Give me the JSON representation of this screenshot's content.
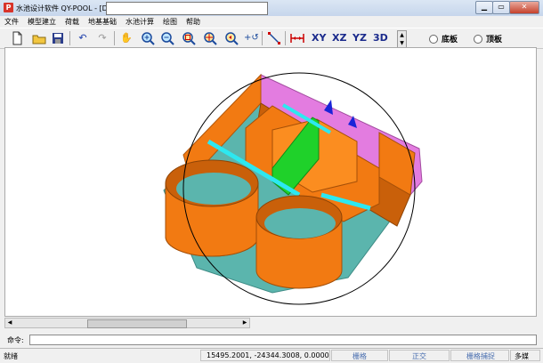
{
  "window": {
    "title": "水池设计软件 QY-POOL - [D:",
    "app_icon_letter": "P"
  },
  "menu": [
    "文件",
    "模型建立",
    "荷载",
    "地基基础",
    "水池计算",
    "绘图",
    "帮助"
  ],
  "toolbar": {
    "view_xy": "XY",
    "view_xz": "XZ",
    "view_yz": "YZ",
    "view_3d": "3D",
    "radio_bottom": "底板",
    "radio_top": "顶板"
  },
  "command": {
    "label": "命令:"
  },
  "status": {
    "ready": "就绪",
    "coordinates": "15495.2001,   -24344.3008,    0.0000",
    "grid": "栅格",
    "ortho": "正交",
    "grid_snap": "栅格捕捉",
    "mode": "多媒"
  },
  "colors": {
    "wall": "#f27a12",
    "wall_dark": "#c9600a",
    "slab": "#5bb5ad",
    "pink": "#e37ce0",
    "green": "#1fd12a",
    "cyan": "#2de8f0",
    "blue": "#1a24d8",
    "canvas_bg": "#ffffff"
  }
}
